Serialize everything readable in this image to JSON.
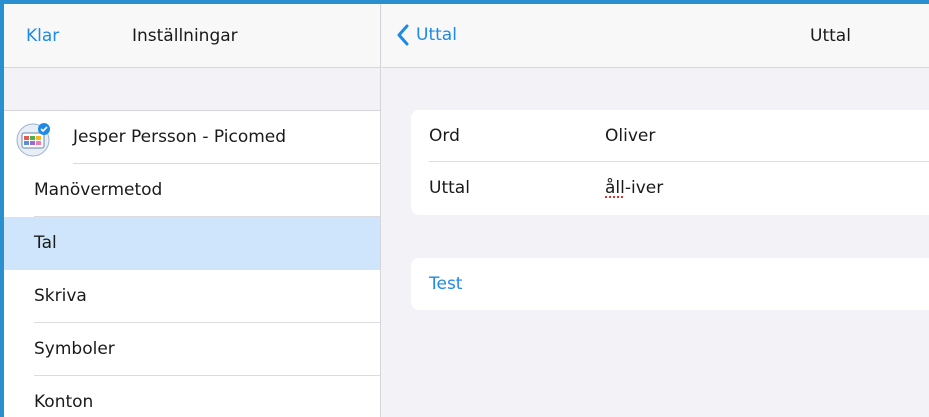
{
  "left": {
    "done_label": "Klar",
    "title": "Inställningar",
    "account": "Jesper Persson - Picomed",
    "items": [
      "Manövermetod",
      "Tal",
      "Skriva",
      "Symboler",
      "Konton"
    ],
    "selected": "Tal"
  },
  "right": {
    "back_label": "Uttal",
    "title": "Uttal",
    "fields": [
      {
        "key": "Ord",
        "value": "Oliver"
      },
      {
        "key": "Uttal",
        "value_a": "åll",
        "value_b": "-iver"
      }
    ],
    "test_label": "Test"
  },
  "colors": {
    "accent": "#1f8ae6",
    "selected_row": "#cfe5fb",
    "frame": "#2a8fcf"
  },
  "icons": {
    "account": "app-avatar-icon",
    "back": "chevron-left-icon"
  }
}
